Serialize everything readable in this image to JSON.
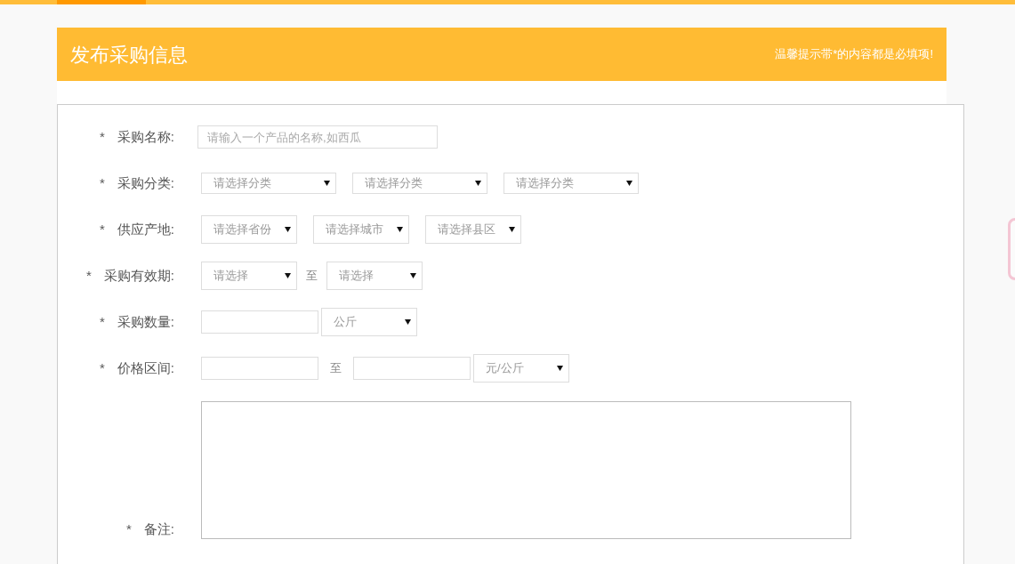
{
  "header": {
    "title": "发布采购信息",
    "tip": "温馨提示带*的内容都是必填项!"
  },
  "fields": [
    {
      "label": "采购名称:",
      "required_mark": "*",
      "controls": [
        {
          "kind": "input",
          "placeholder": "请输入一个产品的名称,如西瓜"
        }
      ]
    },
    {
      "label": "采购分类:",
      "required_mark": "*",
      "controls": [
        {
          "kind": "select",
          "value": "请选择分类"
        },
        {
          "kind": "select",
          "value": "请选择分类"
        },
        {
          "kind": "select",
          "value": "请选择分类"
        }
      ]
    },
    {
      "label": "供应产地:",
      "required_mark": "*",
      "controls": [
        {
          "kind": "select",
          "value": "请选择省份"
        },
        {
          "kind": "select",
          "value": "请选择城市"
        },
        {
          "kind": "select",
          "value": "请选择县区"
        }
      ]
    },
    {
      "label": "采购有效期:",
      "required_mark": "*",
      "controls": [
        {
          "kind": "select",
          "value": "请选择"
        },
        {
          "kind": "separator",
          "text": "至"
        },
        {
          "kind": "select",
          "value": "请选择"
        }
      ]
    },
    {
      "label": "采购数量:",
      "required_mark": "*",
      "controls": [
        {
          "kind": "input"
        },
        {
          "kind": "select",
          "value": "公斤"
        }
      ]
    },
    {
      "label": "价格区间:",
      "required_mark": "*",
      "controls": [
        {
          "kind": "input"
        },
        {
          "kind": "separator",
          "text": "至"
        },
        {
          "kind": "input"
        },
        {
          "kind": "select",
          "value": "元/公斤"
        }
      ]
    },
    {
      "label": "备注:",
      "required_mark": "*",
      "controls": [
        {
          "kind": "textarea"
        }
      ]
    }
  ]
}
